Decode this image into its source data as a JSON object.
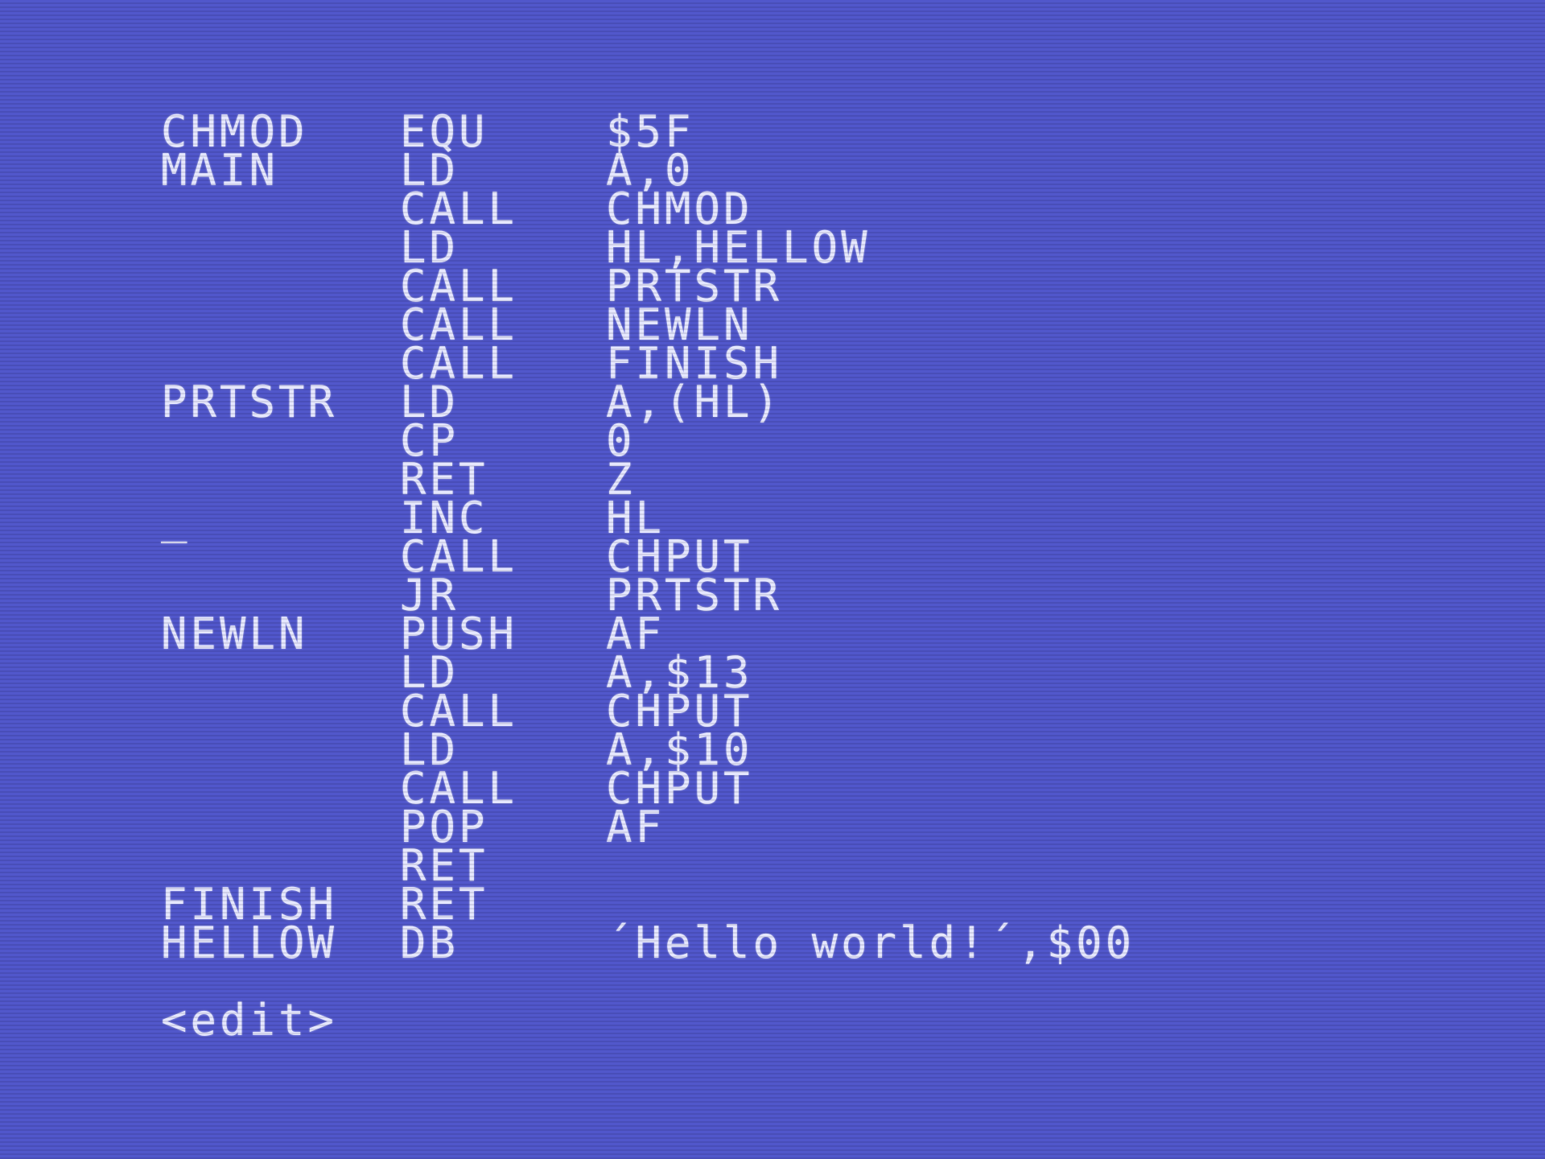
{
  "colors": {
    "background": "#5157cb",
    "text": "#e6e8ff"
  },
  "listing": [
    {
      "label": "CHMOD",
      "op": "EQU",
      "arg": "$5F"
    },
    {
      "label": "MAIN",
      "op": "LD",
      "arg": "A,0"
    },
    {
      "label": "",
      "op": "CALL",
      "arg": "CHMOD"
    },
    {
      "label": "",
      "op": "LD",
      "arg": "HL,HELLOW"
    },
    {
      "label": "",
      "op": "CALL",
      "arg": "PRTSTR"
    },
    {
      "label": "",
      "op": "CALL",
      "arg": "NEWLN"
    },
    {
      "label": "",
      "op": "CALL",
      "arg": "FINISH"
    },
    {
      "label": "PRTSTR",
      "op": "LD",
      "arg": "A,(HL)"
    },
    {
      "label": "",
      "op": "CP",
      "arg": "0"
    },
    {
      "label": "",
      "op": "RET",
      "arg": "Z"
    },
    {
      "label": "_",
      "op": "INC",
      "arg": "HL"
    },
    {
      "label": "",
      "op": "CALL",
      "arg": "CHPUT"
    },
    {
      "label": "",
      "op": "JR",
      "arg": "PRTSTR"
    },
    {
      "label": "NEWLN",
      "op": "PUSH",
      "arg": "AF"
    },
    {
      "label": "",
      "op": "LD",
      "arg": "A,$13"
    },
    {
      "label": "",
      "op": "CALL",
      "arg": "CHPUT"
    },
    {
      "label": "",
      "op": "LD",
      "arg": "A,$10"
    },
    {
      "label": "",
      "op": "CALL",
      "arg": "CHPUT"
    },
    {
      "label": "",
      "op": "POP",
      "arg": "AF"
    },
    {
      "label": "",
      "op": "RET",
      "arg": ""
    },
    {
      "label": "FINISH",
      "op": "RET",
      "arg": ""
    },
    {
      "label": "HELLOW",
      "op": "DB",
      "arg": "´Hello world!´,$00"
    }
  ],
  "status": "<edit>"
}
